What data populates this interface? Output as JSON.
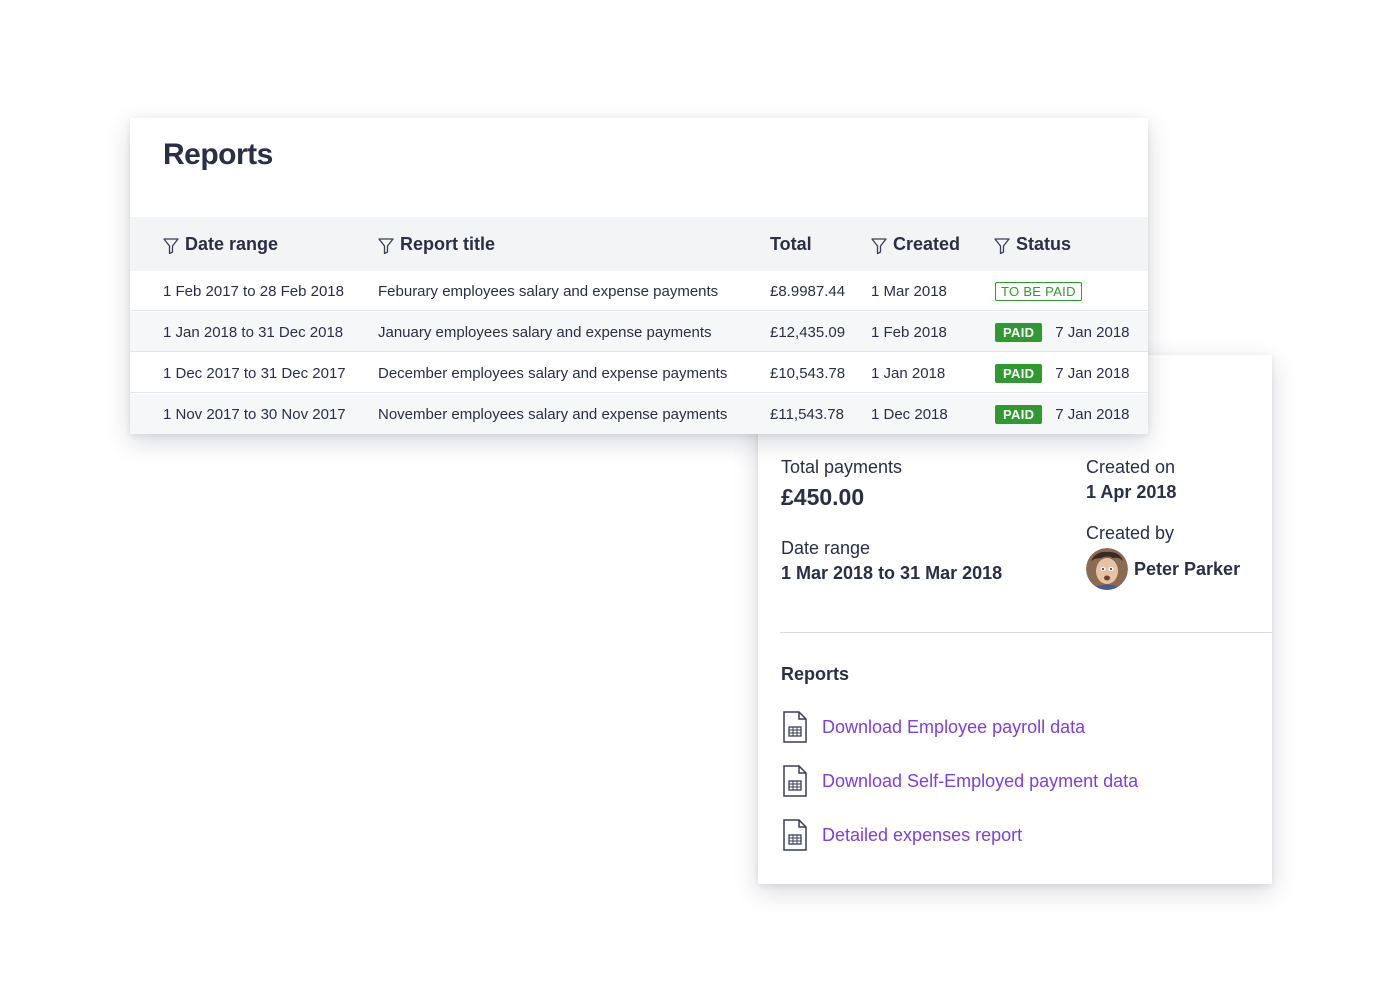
{
  "reports": {
    "title": "Reports",
    "columns": {
      "date_range": "Date range",
      "report_title": "Report title",
      "total": "Total",
      "created": "Created",
      "status": "Status"
    },
    "rows": [
      {
        "date_range": "1 Feb 2017 to 28 Feb 2018",
        "title": "Feburary employees salary and expense payments",
        "total": "£8.9987.44",
        "created": "1 Mar 2018",
        "status": "TO BE PAID",
        "paid_date": ""
      },
      {
        "date_range": "1 Jan 2018 to 31 Dec 2018",
        "title": "January employees salary and expense payments",
        "total": "£12,435.09",
        "created": "1 Feb 2018",
        "status": "PAID",
        "paid_date": "7 Jan 2018"
      },
      {
        "date_range": "1 Dec 2017 to 31 Dec 2017",
        "title": "December employees salary and expense payments",
        "total": "£10,543.78",
        "created": "1 Jan 2018",
        "status": "PAID",
        "paid_date": "7 Jan 2018"
      },
      {
        "date_range": "1 Nov 2017 to 30 Nov 2017",
        "title": "November employees salary and expense payments",
        "total": "£11,543.78",
        "created": "1 Dec 2018",
        "status": "PAID",
        "paid_date": "7 Jan 2018"
      }
    ]
  },
  "detail": {
    "total_payments_label": "Total payments",
    "total_payments_value": "£450.00",
    "created_on_label": "Created on",
    "created_on_value": "1 Apr 2018",
    "date_range_label": "Date range",
    "date_range_value": "1 Mar 2018 to 31 Mar 2018",
    "created_by_label": "Created by",
    "created_by_name": "Peter Parker",
    "reports_heading": "Reports",
    "links": [
      "Download Employee payroll data",
      "Download Self-Employed payment data",
      "Detailed expenses report"
    ]
  },
  "colors": {
    "text": "#2a2f45",
    "link": "#7b3fe4",
    "paid_green": "#2f9a2f",
    "header_bg": "#f3f4f6"
  },
  "icons": {
    "filter": "filter-funnel-icon",
    "file": "spreadsheet-file-icon",
    "avatar": "user-avatar"
  }
}
